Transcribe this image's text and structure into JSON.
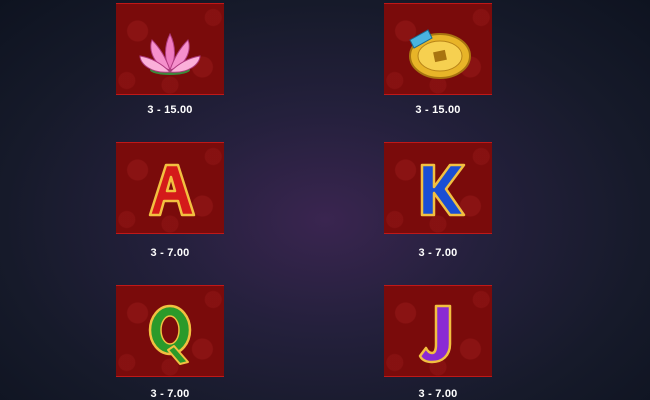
{
  "paytable": {
    "symbols": [
      {
        "name": "lotus",
        "pay": "3 - 15.00"
      },
      {
        "name": "coin",
        "pay": "3 - 15.00"
      },
      {
        "name": "A",
        "pay": "3 - 7.00"
      },
      {
        "name": "K",
        "pay": "3 - 7.00"
      },
      {
        "name": "Q",
        "pay": "3 - 7.00"
      },
      {
        "name": "J",
        "pay": "3 - 7.00"
      }
    ]
  },
  "colors": {
    "tile": "#7a0b0b",
    "tile_border": "#c01818",
    "letter_A": "#d41a1a",
    "letter_K": "#1a4ed4",
    "letter_Q": "#2a9a2a",
    "letter_J": "#8a2ad4",
    "gold": "#e8b428"
  }
}
